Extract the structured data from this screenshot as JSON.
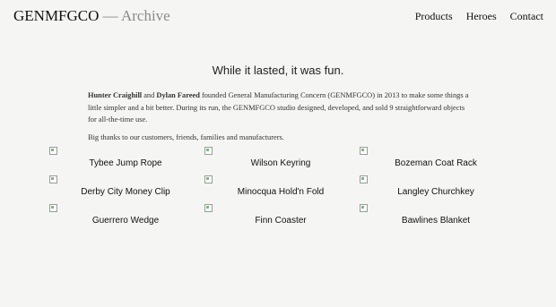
{
  "header": {
    "brand": "GENMFGCO",
    "subtitle": "— Archive",
    "nav": [
      "Products",
      "Heroes",
      "Contact"
    ]
  },
  "headline": "While it lasted, it was fun.",
  "intro": {
    "founder1": "Hunter Craighill",
    "and": "and",
    "founder2": "Dylan Fareed",
    "p1_rest": "founded General Manufacturing Concern (GENMFGCO) in 2013 to make some things a little simpler and a bit better. During its run, the GENMFGCO studio designed, developed, and sold 9 straightforward objects for all-the-time use.",
    "p2": "Big thanks to our customers, friends, families and manufacturers."
  },
  "products": [
    [
      "Tybee Jump Rope",
      "Wilson Keyring",
      "Bozeman Coat Rack"
    ],
    [
      "Derby City Money Clip",
      "Minocqua Hold'n Fold",
      "Langley Churchkey"
    ],
    [
      "Guerrero Wedge",
      "Finn Coaster",
      "Bawlines Blanket"
    ]
  ]
}
